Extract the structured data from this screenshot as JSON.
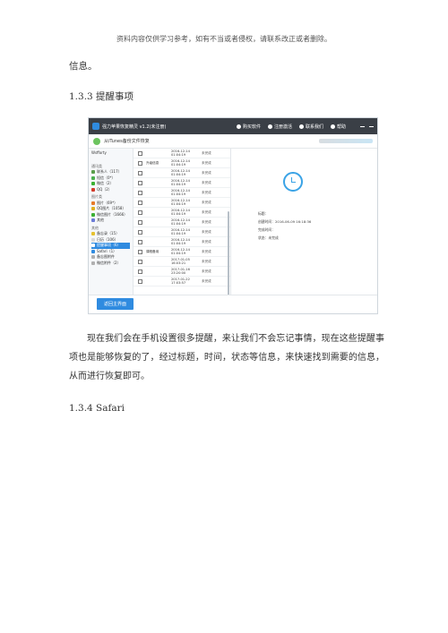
{
  "header_note": "资料内容仅供学习参考，如有不当或者侵权，请联系改正或者删除。",
  "info_line": "信息。",
  "section_133": "1.3.3 提醒事项",
  "body_paragraph": "现在我们会在手机设置很多提醒，来让我们不会忘记事情，现在这些提醒事项也是能够恢复的了，经过标题，时间，状态等信息，来快速找到需要的信息，从而进行恢复即可。",
  "section_134": "1.3.4 Safari",
  "screenshot": {
    "app_title": "强力苹果恢复精灵 v1.2(未注册)",
    "toolbar": [
      "购买软件",
      "注册激活",
      "联系我们",
      "帮助"
    ],
    "backup_title": "从iTunes备份文件恢复",
    "sidebar_top": "Wsfforty",
    "sidebar": [
      {
        "cat": "通讯类"
      },
      {
        "label": "联系人（117）",
        "color": "#5a9e4b"
      },
      {
        "label": "短信（0*）",
        "color": "#4cb050"
      },
      {
        "label": "微信（2）",
        "color": "#3cb034"
      },
      {
        "label": "QQ（2）",
        "color": "#d23b2b"
      },
      {
        "cat": "图片类"
      },
      {
        "label": "图片（69*）",
        "color": "#e67b2a"
      },
      {
        "label": "QQ图片（1058）",
        "color": "#e0b020"
      },
      {
        "label": "微信图片（1666）",
        "color": "#3cb034"
      },
      {
        "label": "其他",
        "color": "#6a7bd6"
      },
      {
        "cat": "其他"
      },
      {
        "label": "备忘录（15）",
        "color": "#e6c230"
      },
      {
        "label": "日历（106）",
        "color": "#d9d9d9"
      },
      {
        "label": "提醒事项（6）",
        "color": "#ffffff",
        "active": true
      },
      {
        "label": "Safari（1）",
        "color": "#2f8be0"
      },
      {
        "label": "备忘图附件",
        "color": "#b0b0b0"
      },
      {
        "label": "微信附件（2）",
        "color": "#b0b0b0"
      }
    ],
    "rows": [
      {
        "title": "",
        "date": "2016-12-14 01:04:19",
        "status": "未完成"
      },
      {
        "title": "升级信息",
        "date": "2016-12-14 01:04:19",
        "status": "未完成"
      },
      {
        "title": "",
        "date": "2016-12-14 01:04:19",
        "status": "未完成"
      },
      {
        "title": "",
        "date": "2016-12-14 01:04:19",
        "status": "未完成"
      },
      {
        "title": "",
        "date": "2016-12-14 01:04:19",
        "status": "未完成"
      },
      {
        "title": "",
        "date": "2016-12-14 01:04:19",
        "status": "未完成"
      },
      {
        "title": "",
        "date": "2016-12-14 01:04:19",
        "status": "未完成"
      },
      {
        "title": "",
        "date": "2016-12-14 01:04:19",
        "status": "未完成"
      },
      {
        "title": "",
        "date": "2016-12-14 01:04:19",
        "status": "未完成"
      },
      {
        "title": "",
        "date": "2016-12-14 01:04:19",
        "status": "未完成"
      },
      {
        "title": "课程备用",
        "date": "2016-12-14 01:04:19",
        "status": "未完成"
      },
      {
        "title": "",
        "date": "2017-01-05 16:03:21",
        "status": "未完成"
      },
      {
        "title": "",
        "date": "2017-01-16 23:20:00",
        "status": "未完成"
      },
      {
        "title": "",
        "date": "2017-01-22 17:03:57",
        "status": "未完成"
      }
    ],
    "detail": {
      "title_label": "标题：",
      "created_label": "创建时间：2016-06-09 16:18:36",
      "remind_label": "完成时间：",
      "status_label": "状态：未完成"
    },
    "back_button": "返回主界面"
  }
}
